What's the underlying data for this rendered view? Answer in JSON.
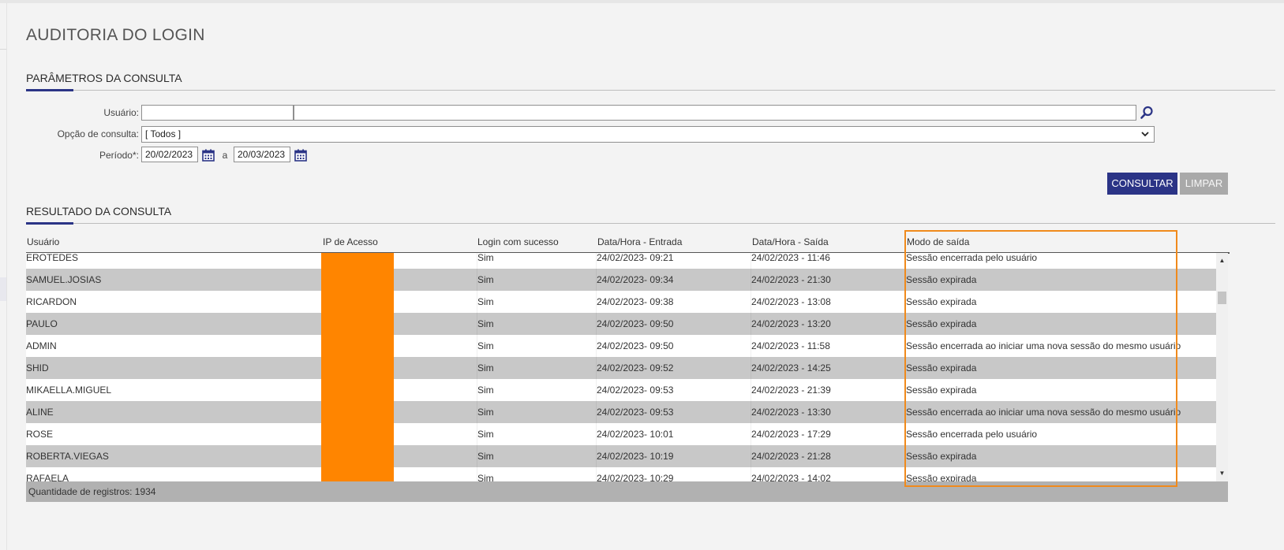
{
  "page": {
    "title": "AUDITORIA DO LOGIN"
  },
  "params": {
    "title": "PARÂMETROS DA CONSULTA",
    "usuario_label": "Usuário:",
    "usuario_code": "",
    "usuario_name": "",
    "opcao_label": "Opção de consulta:",
    "opcao_value": "[ Todos ]",
    "periodo_label": "Período*:",
    "periodo_start": "20/02/2023",
    "periodo_sep": "a",
    "periodo_end": "20/03/2023"
  },
  "actions": {
    "consultar": "CONSULTAR",
    "limpar": "LIMPAR"
  },
  "result": {
    "title": "RESULTADO DA CONSULTA",
    "columns": [
      "Usuário",
      "IP de Acesso",
      "Login com sucesso",
      "Data/Hora - Entrada",
      "Data/Hora - Saída",
      "Modo de saída"
    ],
    "rows": [
      {
        "usuario": "EROTEDES",
        "sucesso": "Sim",
        "entrada": "24/02/2023- 09:21",
        "saida": "24/02/2023 - 11:46",
        "modo": "Sessão encerrada pelo usuário"
      },
      {
        "usuario": "SAMUEL.JOSIAS",
        "sucesso": "Sim",
        "entrada": "24/02/2023- 09:34",
        "saida": "24/02/2023 - 21:30",
        "modo": "Sessão expirada"
      },
      {
        "usuario": "RICARDON",
        "sucesso": "Sim",
        "entrada": "24/02/2023- 09:38",
        "saida": "24/02/2023 - 13:08",
        "modo": "Sessão expirada"
      },
      {
        "usuario": "PAULO",
        "sucesso": "Sim",
        "entrada": "24/02/2023- 09:50",
        "saida": "24/02/2023 - 13:20",
        "modo": "Sessão expirada"
      },
      {
        "usuario": "ADMIN",
        "sucesso": "Sim",
        "entrada": "24/02/2023- 09:50",
        "saida": "24/02/2023 - 11:58",
        "modo": "Sessão encerrada ao iniciar uma nova sessão do mesmo usuário"
      },
      {
        "usuario": "SHID",
        "sucesso": "Sim",
        "entrada": "24/02/2023- 09:52",
        "saida": "24/02/2023 - 14:25",
        "modo": "Sessão expirada"
      },
      {
        "usuario": "MIKAELLA.MIGUEL",
        "sucesso": "Sim",
        "entrada": "24/02/2023- 09:53",
        "saida": "24/02/2023 - 21:39",
        "modo": "Sessão expirada"
      },
      {
        "usuario": "ALINE",
        "sucesso": "Sim",
        "entrada": "24/02/2023- 09:53",
        "saida": "24/02/2023 - 13:30",
        "modo": "Sessão encerrada ao iniciar uma nova sessão do mesmo usuário"
      },
      {
        "usuario": "ROSE",
        "sucesso": "Sim",
        "entrada": "24/02/2023- 10:01",
        "saida": "24/02/2023 - 17:29",
        "modo": "Sessão encerrada pelo usuário"
      },
      {
        "usuario": "ROBERTA.VIEGAS",
        "sucesso": "Sim",
        "entrada": "24/02/2023- 10:19",
        "saida": "24/02/2023 - 21:28",
        "modo": "Sessão expirada"
      },
      {
        "usuario": "RAFAELA",
        "sucesso": "Sim",
        "entrada": "24/02/2023- 10:29",
        "saida": "24/02/2023 - 14:02",
        "modo": "Sessão expirada"
      }
    ],
    "footer_label": "Quantidade de registros:",
    "footer_count": "1934"
  },
  "icons": {
    "search": "magnifier-icon",
    "calendar": "calendar-icon",
    "chevron": "chevron-down-icon"
  },
  "colors": {
    "accent": "#2b3486",
    "highlight": "#f08a1c",
    "mask": "#ff8500"
  }
}
